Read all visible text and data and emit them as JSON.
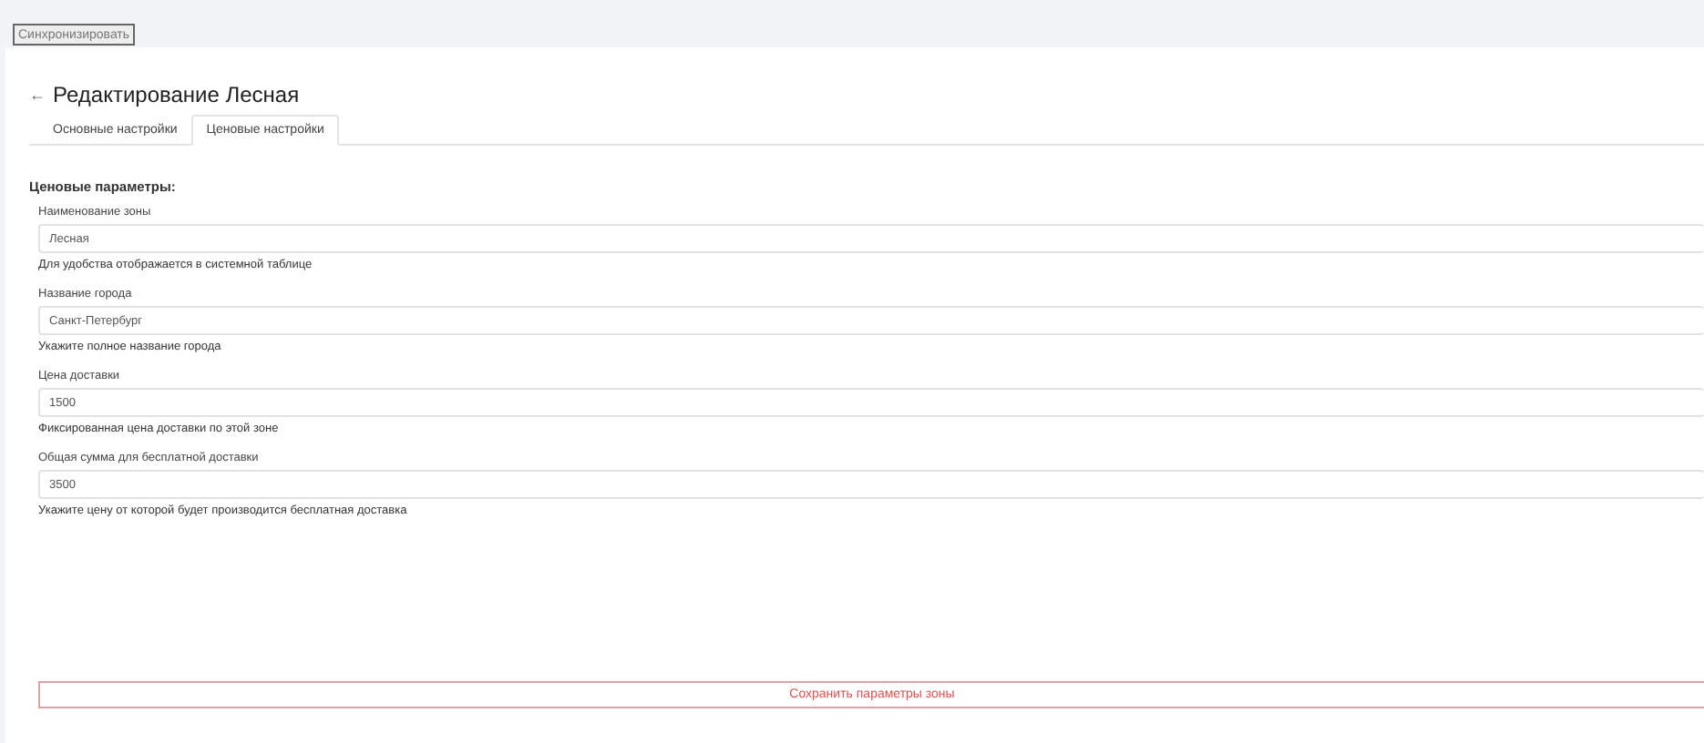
{
  "sync_button": "Синхронизировать",
  "page": {
    "back_icon": "←",
    "title": "Редактирование Лесная"
  },
  "tabs": [
    {
      "label": "Основные настройки",
      "selected": false
    },
    {
      "label": "Ценовые настройки",
      "selected": true
    }
  ],
  "section_title": "Ценовые параметры:",
  "fields": [
    {
      "label": "Наименование зоны",
      "value": "Лесная",
      "hint": "Для удобства отображается в системной таблице"
    },
    {
      "label": "Название города",
      "value": "Санкт-Петербург",
      "hint": "Укажите полное название города"
    },
    {
      "label": "Цена доставки",
      "value": "1500",
      "hint": "Фиксированная цена доставки по этой зоне"
    },
    {
      "label": "Общая сумма для бесплатной доставки",
      "value": "3500",
      "hint": "Укажите цену от которой будет производится бесплатная доставка"
    }
  ],
  "save_button": "Сохранить параметры зоны"
}
